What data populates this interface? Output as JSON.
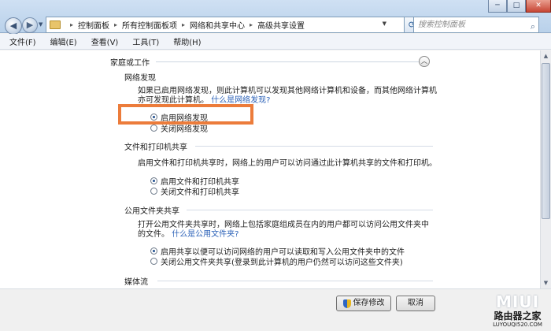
{
  "window": {
    "breadcrumbs": [
      "控制面板",
      "所有控制面板项",
      "网络和共享中心",
      "高级共享设置"
    ],
    "search_placeholder": "搜索控制面板",
    "controls": {
      "minimize": "─",
      "maximize": "□",
      "close": "✕"
    }
  },
  "icons": {
    "back": "back-arrow-icon",
    "forward": "forward-arrow-icon",
    "refresh": "refresh-icon",
    "search": "search-icon",
    "collapse": "chevron-up-icon",
    "shield": "uac-shield-icon"
  },
  "menu": [
    {
      "label": "文件(F)"
    },
    {
      "label": "编辑(E)"
    },
    {
      "label": "查看(V)"
    },
    {
      "label": "工具(T)"
    },
    {
      "label": "帮助(H)"
    }
  ],
  "group": {
    "title": "家庭或工作"
  },
  "sections": {
    "network_discovery": {
      "title": "网络发现",
      "description": "如果已启用网络发现，则此计算机可以发现其他网络计算机和设备，而其他网络计算机亦可发现此计算机。",
      "link": "什么是网络发现?",
      "options": [
        {
          "label": "启用网络发现",
          "selected": true
        },
        {
          "label": "关闭网络发现",
          "selected": false
        }
      ]
    },
    "file_printer_sharing": {
      "title": "文件和打印机共享",
      "description": "启用文件和打印机共享时，网络上的用户可以访问通过此计算机共享的文件和打印机。",
      "options": [
        {
          "label": "启用文件和打印机共享",
          "selected": true
        },
        {
          "label": "关闭文件和打印机共享",
          "selected": false
        }
      ]
    },
    "public_folder_sharing": {
      "title": "公用文件夹共享",
      "description": "打开公用文件夹共享时，网络上包括家庭组成员在内的用户都可以访问公用文件夹中的文件。",
      "link": "什么是公用文件夹?",
      "options": [
        {
          "label": "启用共享以便可以访问网络的用户可以读取和写入公用文件夹中的文件",
          "selected": true
        },
        {
          "label": "关闭公用文件夹共享(登录到此计算机的用户仍然可以访问这些文件夹)",
          "selected": false
        }
      ]
    },
    "media_streaming": {
      "title": "媒体流"
    }
  },
  "footer": {
    "save_label": "保存修改",
    "cancel_label": "取消"
  },
  "watermark": {
    "brand": "MIUI",
    "name": "路由器之家",
    "url": "LUYOUQI520.COM"
  },
  "colors": {
    "highlight_box": "#ec7c3b",
    "link": "#2c62b8",
    "titlebar": "#b9d1ea"
  }
}
